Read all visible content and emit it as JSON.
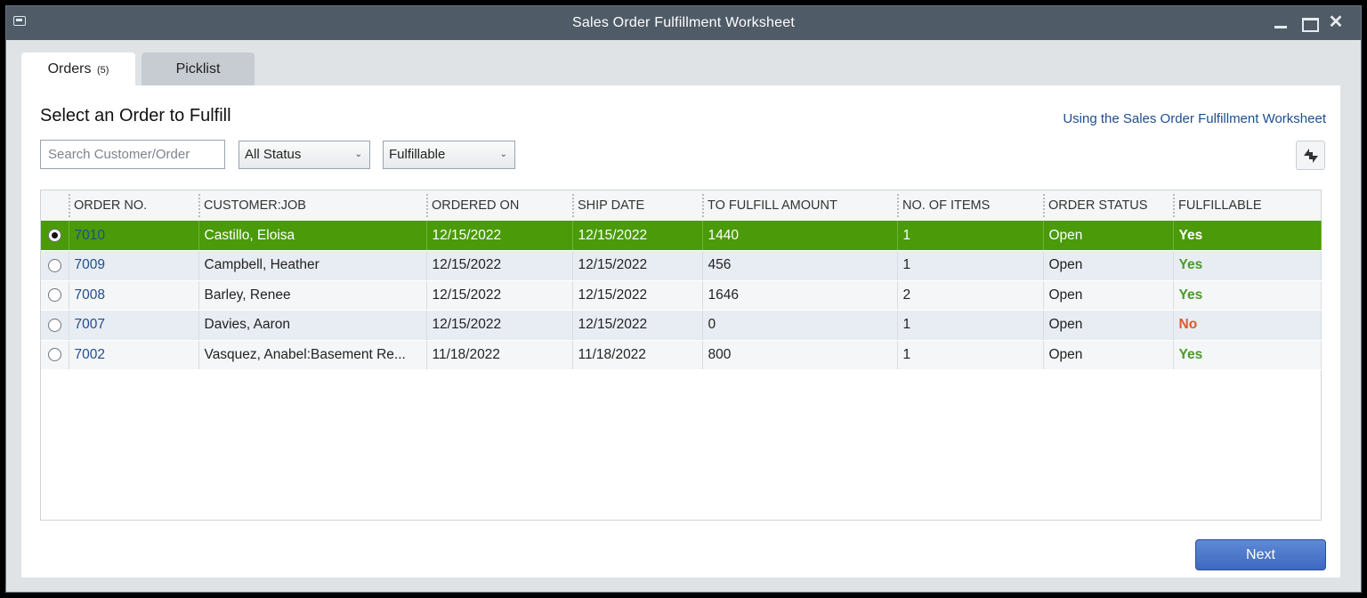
{
  "window": {
    "title": "Sales Order Fulfillment Worksheet",
    "close_glyph": "✕"
  },
  "tabs": [
    {
      "label": "Orders",
      "count": "(5)"
    },
    {
      "label": "Picklist"
    }
  ],
  "heading": "Select an Order to Fulfill",
  "help_link": "Using the Sales Order Fulfillment Worksheet",
  "search": {
    "placeholder": "Search Customer/Order",
    "value": ""
  },
  "filters": {
    "status": "All Status",
    "fulfillable": "Fulfillable",
    "chevron": "⌄"
  },
  "columns": [
    "ORDER NO.",
    "CUSTOMER:JOB",
    "ORDERED ON",
    "SHIP DATE",
    "TO FULFILL AMOUNT",
    "NO. OF ITEMS",
    "ORDER STATUS",
    "FULFILLABLE"
  ],
  "rows": [
    {
      "order_no": "7010",
      "customer_job": "Castillo, Eloisa",
      "ordered_on": "12/15/2022",
      "ship_date": "12/15/2022",
      "amount": "1440",
      "items": "1",
      "status": "Open",
      "fulfillable": "Yes"
    },
    {
      "order_no": "7009",
      "customer_job": "Campbell, Heather",
      "ordered_on": "12/15/2022",
      "ship_date": "12/15/2022",
      "amount": "456",
      "items": "1",
      "status": "Open",
      "fulfillable": "Yes"
    },
    {
      "order_no": "7008",
      "customer_job": "Barley, Renee",
      "ordered_on": "12/15/2022",
      "ship_date": "12/15/2022",
      "amount": "1646",
      "items": "2",
      "status": "Open",
      "fulfillable": "Yes"
    },
    {
      "order_no": "7007",
      "customer_job": "Davies, Aaron",
      "ordered_on": "12/15/2022",
      "ship_date": "12/15/2022",
      "amount": "0",
      "items": "1",
      "status": "Open",
      "fulfillable": "No"
    },
    {
      "order_no": "7002",
      "customer_job": "Vasquez, Anabel:Basement Re...",
      "ordered_on": "11/18/2022",
      "ship_date": "11/18/2022",
      "amount": "800",
      "items": "1",
      "status": "Open",
      "fulfillable": "Yes"
    }
  ],
  "selected_row": 0,
  "next_button": "Next",
  "colors": {
    "selected_row": "#4a9a09",
    "yes": "#4a9a2a",
    "no": "#e0592a",
    "link": "#1f4e8c",
    "titlebar": "#4f5b66"
  }
}
